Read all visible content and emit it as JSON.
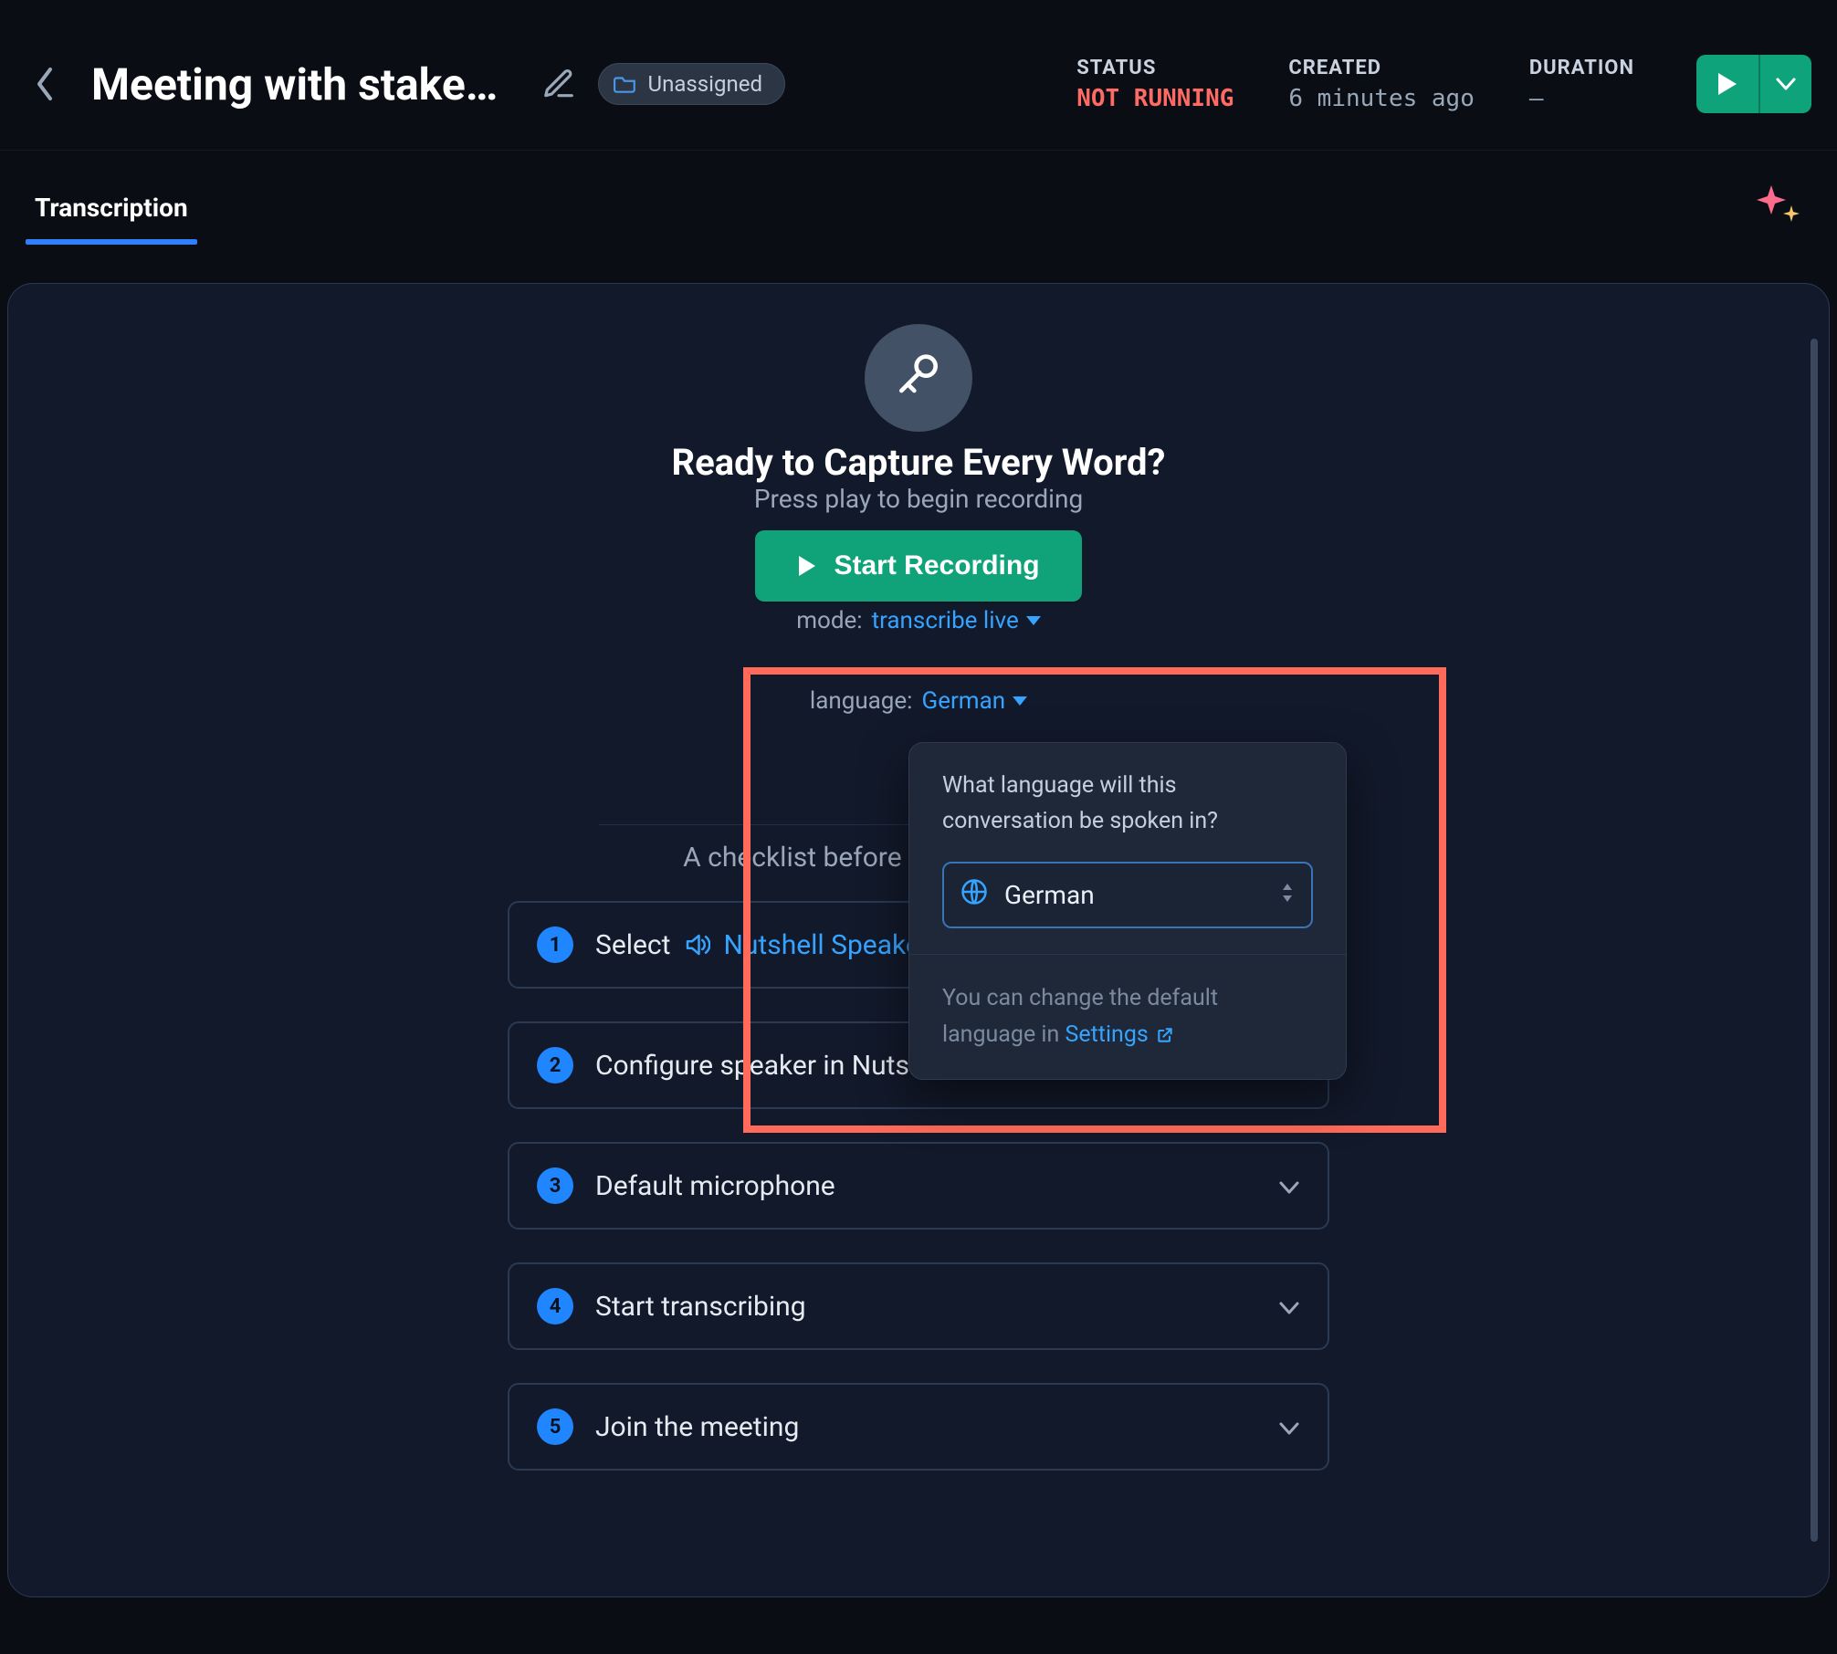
{
  "header": {
    "title": "Meeting with stakeholde…",
    "chip_label": "Unassigned",
    "status_label": "STATUS",
    "status_value": "NOT RUNNING",
    "created_label": "CREATED",
    "created_value": "6 minutes ago",
    "duration_label": "DURATION",
    "duration_value": "–"
  },
  "tabs": {
    "transcription": "Transcription"
  },
  "hero": {
    "title": "Ready to Capture Every Word?",
    "subtitle": "Press play to begin recording",
    "start_button": "Start Recording",
    "mode_label": "mode:",
    "mode_value": "transcribe live",
    "language_label": "language:",
    "language_value": "German"
  },
  "popover": {
    "question": "What language will this conversation be spoken in?",
    "selected_language": "German",
    "hint_prefix": "You can change the default language in ",
    "settings_label": "Settings"
  },
  "checklist": {
    "title": "A checklist before starting the meeting",
    "items": {
      "0": {
        "num": "1",
        "prefix": "Select",
        "link": "Nutshell Speaker"
      },
      "1": {
        "num": "2",
        "label": "Configure speaker in Nutshell desktop app"
      },
      "2": {
        "num": "3",
        "label": "Default microphone"
      },
      "3": {
        "num": "4",
        "label": "Start transcribing"
      },
      "4": {
        "num": "5",
        "label": "Join the meeting"
      }
    }
  }
}
